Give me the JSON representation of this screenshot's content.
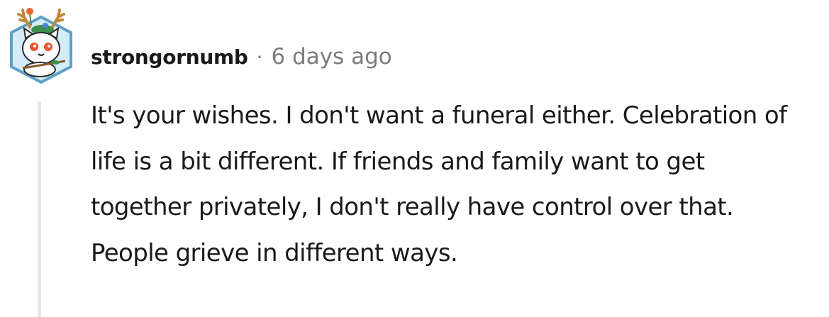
{
  "comment": {
    "author": "strongornumb",
    "separator": "·",
    "timestamp": "6 days ago",
    "body": "It's your wishes. I don't want a funeral either. Celebration of life is a bit different. If friends and family want to get together privately, I don't really have control over that. People grieve in different ways."
  },
  "avatar": {
    "icon": "antlered-cat-avatar-icon",
    "colors": {
      "hex_frame": "#5fa0c8",
      "hex_fill": "#d4ecf7",
      "antlers": "#c4873c",
      "body": "#ffffff",
      "eyes": "#e8542c",
      "moss": "#3e8f4a",
      "flower": "#f0642c"
    }
  },
  "colors": {
    "text": "#1a1a1b",
    "meta": "#7c7c7c",
    "thread_line": "#e6e6e6"
  }
}
